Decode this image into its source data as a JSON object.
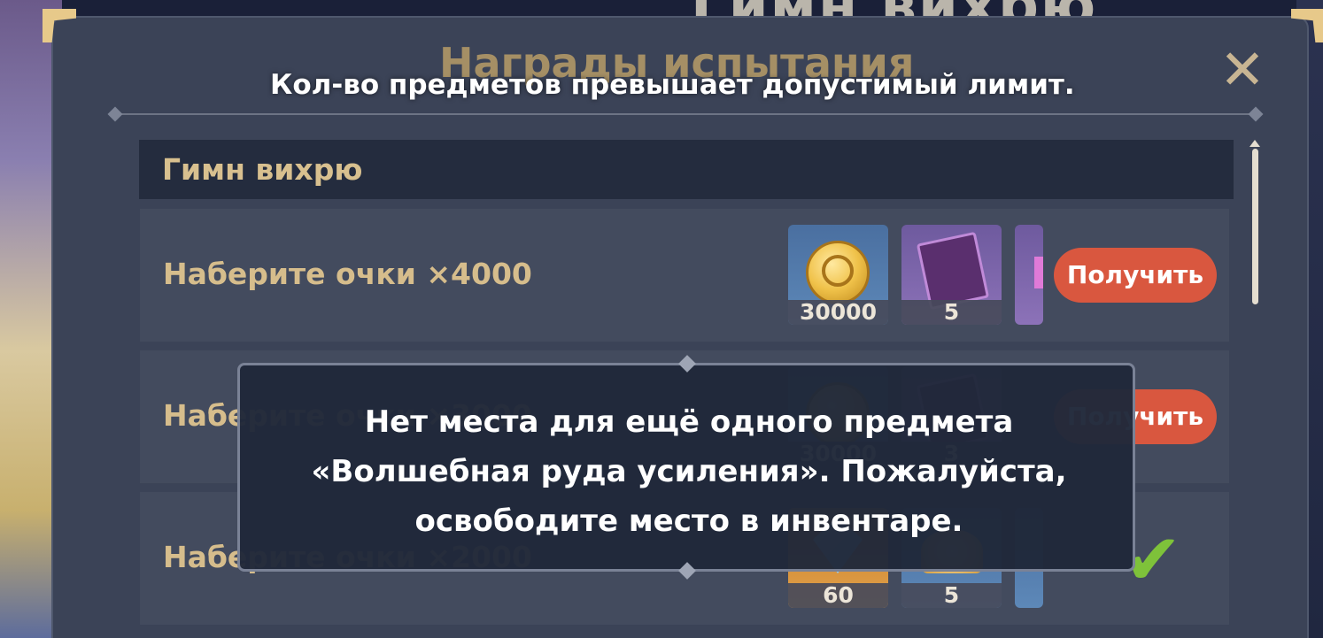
{
  "background": {
    "title": "Гимн вихрю"
  },
  "panel": {
    "title": "Награды испытания",
    "close_icon": "close-icon"
  },
  "toast": {
    "message": "Кол-во предметов превышает допустимый лимит."
  },
  "section": {
    "title": "Гимн вихрю"
  },
  "rows": [
    {
      "label": "Наберите очки ×4000",
      "rewards": [
        {
          "icon": "mora-coin-icon",
          "count": "30000"
        },
        {
          "icon": "book-icon",
          "count": "5"
        },
        {
          "icon": "ore-icon",
          "count": ""
        }
      ],
      "action": "Получить"
    },
    {
      "label": "Наберите очки ×3000",
      "rewards": [
        {
          "icon": "mora-coin-icon",
          "count": "30000"
        },
        {
          "icon": "book-icon",
          "count": "3"
        }
      ],
      "action": "Получить"
    },
    {
      "label": "Наберите очки ×2000",
      "rewards": [
        {
          "icon": "primogem-icon",
          "count": "60"
        },
        {
          "icon": "fan-icon",
          "count": "5"
        }
      ],
      "action_icon": "checkmark-icon"
    }
  ],
  "dialog": {
    "message": "Нет места для ещё одного предмета «Волшебная руда усиления». Пожалуйста, освободите место в инвентаре."
  },
  "colors": {
    "accent_gold": "#d6bd8c",
    "claim_red": "#d9573f",
    "check_green": "#7ec23a",
    "panel_bg": "#3b4357"
  }
}
